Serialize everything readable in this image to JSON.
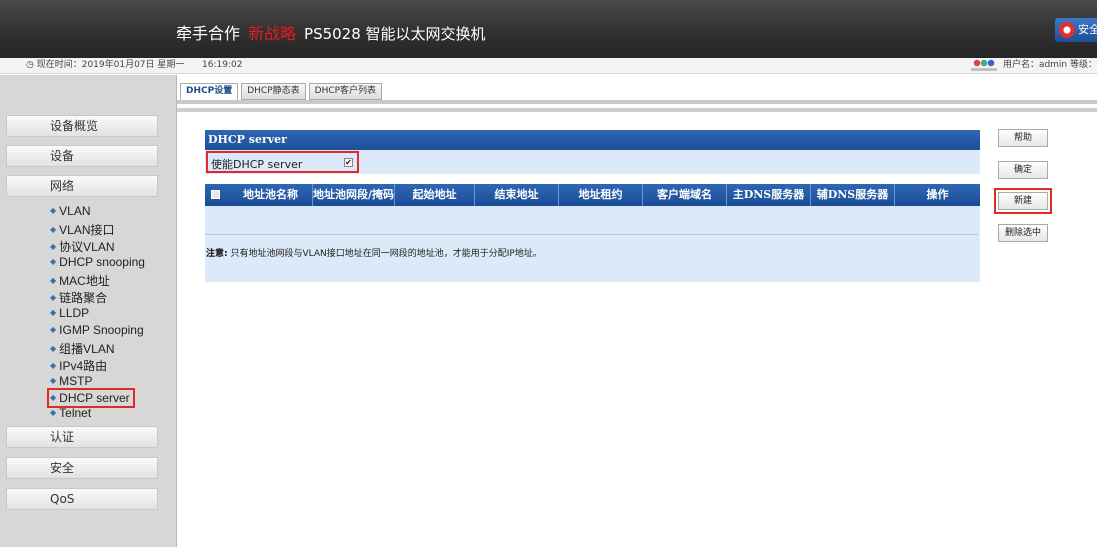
{
  "header": {
    "company": "牵手合作",
    "brand_accent": "新战略",
    "product": "PS5028 智能以太网交换机",
    "security_button": "安全",
    "accent_color": "#e21d1d"
  },
  "infobar": {
    "clock_label": "◷ 现在时间：2019年01月07日 星期一",
    "time": "16:19:02",
    "user_text": "用户名：admin 等级："
  },
  "sidebar": {
    "sections": [
      {
        "label": "设备概览"
      },
      {
        "label": "设备"
      },
      {
        "label": "网络"
      },
      {
        "label": "认证"
      },
      {
        "label": "安全"
      },
      {
        "label": "QoS"
      }
    ],
    "network_items": [
      {
        "label": "VLAN"
      },
      {
        "label": "VLAN接口"
      },
      {
        "label": "协议VLAN"
      },
      {
        "label": "DHCP snooping"
      },
      {
        "label": "MAC地址"
      },
      {
        "label": "链路聚合"
      },
      {
        "label": "LLDP"
      },
      {
        "label": "IGMP Snooping"
      },
      {
        "label": "组播VLAN"
      },
      {
        "label": "IPv4路由"
      },
      {
        "label": "MSTP"
      },
      {
        "label": "DHCP server"
      },
      {
        "label": "Telnet"
      }
    ],
    "active_item": "DHCP server"
  },
  "tabs": [
    {
      "label": "DHCP设置",
      "active": true
    },
    {
      "label": "DHCP静态表",
      "active": false
    },
    {
      "label": "DHCP客户列表",
      "active": false
    }
  ],
  "panel": {
    "title": "DHCP server",
    "enable_label": "使能DHCP server",
    "enable_checked": true,
    "columns": [
      "地址池名称",
      "地址池网段/掩码",
      "起始地址",
      "结束地址",
      "地址租约",
      "客户端域名",
      "主DNS服务器",
      "辅DNS服务器",
      "操作"
    ],
    "rows": [],
    "note_label": "注意:",
    "note_text": " 只有地址池网段与VLAN接口地址在同一网段的地址池，才能用于分配IP地址。"
  },
  "actions": {
    "help": "帮助",
    "confirm": "确定",
    "new": "新建",
    "delete_selected": "删除选中"
  }
}
